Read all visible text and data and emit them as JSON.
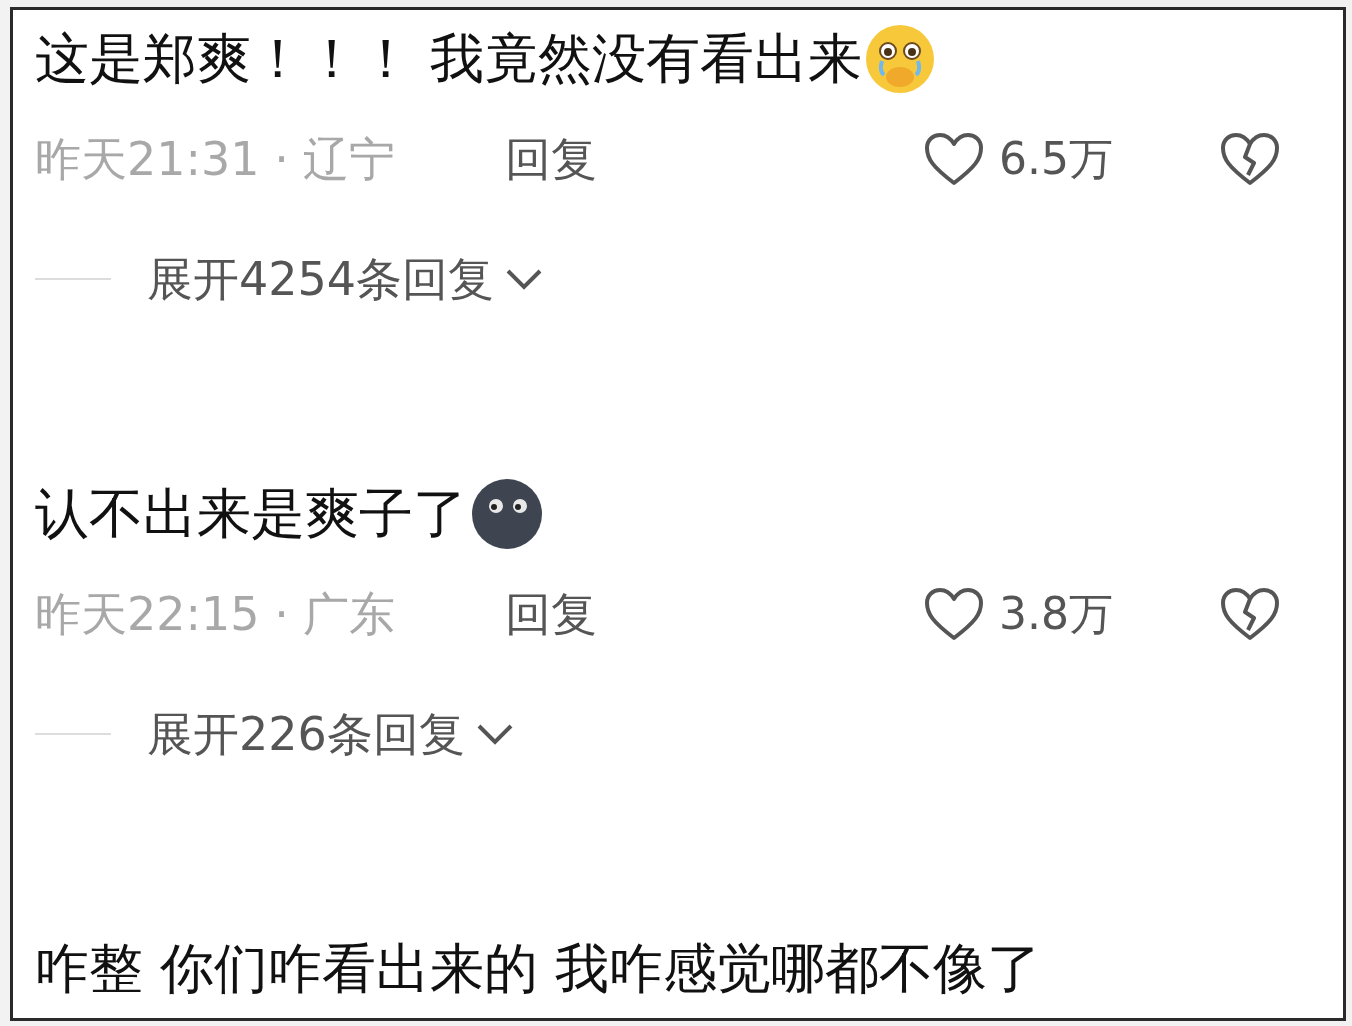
{
  "comments": [
    {
      "text": "这是郑爽！！！ 我竟然没有看出来",
      "emoji": {
        "kind": "crying"
      },
      "meta": "昨天21:31 · 辽宁",
      "reply": "回复",
      "likes": "6.5万",
      "expand": "展开4254条回复"
    },
    {
      "text": "认不出来是爽子了",
      "emoji": {
        "kind": "moon"
      },
      "meta": "昨天22:15 · 广东",
      "reply": "回复",
      "likes": "3.8万",
      "expand": "展开226条回复"
    },
    {
      "text": "咋整 你们咋看出来的 我咋感觉哪都不像了"
    }
  ]
}
